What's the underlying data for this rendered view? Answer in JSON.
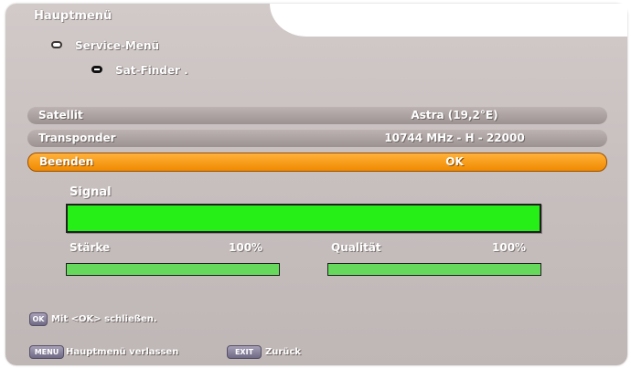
{
  "header": {
    "title": "Hauptmenü",
    "breadcrumb": [
      {
        "label": "Service-Menü",
        "icon": "remote-outline-icon"
      },
      {
        "label": "Sat-Finder .",
        "icon": "remote-filled-icon"
      }
    ]
  },
  "rows": [
    {
      "label": "Satellit",
      "value": "Astra (19,2°E)"
    },
    {
      "label": "Transponder",
      "value": "10744 MHz - H - 22000"
    },
    {
      "label": "Beenden",
      "value": "OK",
      "selected": true
    }
  ],
  "signal": {
    "title": "Signal",
    "level": 1.0,
    "strength_label": "Stärke",
    "strength_value": "100%",
    "strength_level": 1.0,
    "quality_label": "Qualität",
    "quality_value": "100%",
    "quality_level": 1.0
  },
  "footer": {
    "ok_button": "OK",
    "ok_hint": "Mit <OK> schließen.",
    "menu_button": "MENU",
    "menu_hint": "Hauptmenü verlassen",
    "exit_button": "EXIT",
    "exit_hint": "Zurück"
  },
  "colors": {
    "signal_green": "#26ee17",
    "bar_green": "#66d85c",
    "selected_orange": "#f08a00",
    "panel_grey": "#c8c0bf"
  }
}
